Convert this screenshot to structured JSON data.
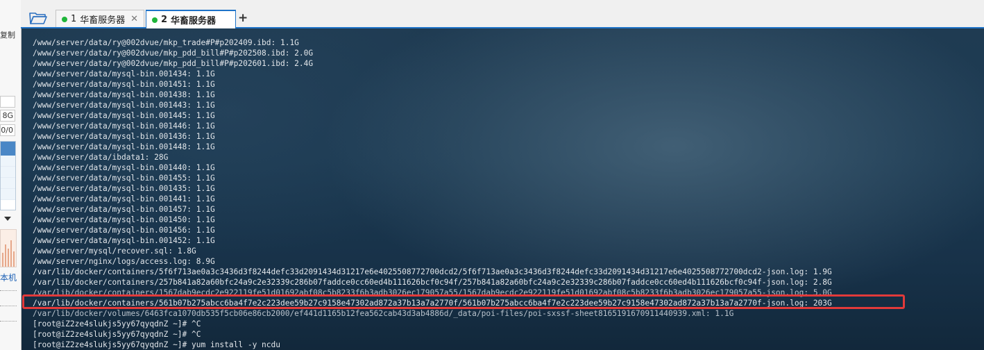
{
  "side_panel": {
    "copy_text": "复制",
    "values": [
      "",
      "8G",
      "0/0"
    ],
    "link_text": "本机"
  },
  "tabs": [
    {
      "number": "1",
      "label": "华畜服务器",
      "active": false,
      "status": "connected"
    },
    {
      "number": "2",
      "label": "华畜服务器",
      "active": true,
      "status": "connected"
    }
  ],
  "colors": {
    "status_connected": "#1fb53a",
    "highlight": "#e23a3a",
    "accent": "#1e73c8"
  },
  "icons": {
    "folder": "folder-open-icon",
    "close": "close-icon",
    "add": "plus-icon"
  },
  "terminal": {
    "lines": [
      "/www/server/data/ry@002dvue/mkp_trade#P#p202409.ibd: 1.1G",
      "/www/server/data/ry@002dvue/mkp_pdd_bill#P#p202508.ibd: 2.0G",
      "/www/server/data/ry@002dvue/mkp_pdd_bill#P#p202601.ibd: 2.4G",
      "/www/server/data/mysql-bin.001434: 1.1G",
      "/www/server/data/mysql-bin.001451: 1.1G",
      "/www/server/data/mysql-bin.001438: 1.1G",
      "/www/server/data/mysql-bin.001443: 1.1G",
      "/www/server/data/mysql-bin.001445: 1.1G",
      "/www/server/data/mysql-bin.001446: 1.1G",
      "/www/server/data/mysql-bin.001436: 1.1G",
      "/www/server/data/mysql-bin.001448: 1.1G",
      "/www/server/data/ibdata1: 28G",
      "/www/server/data/mysql-bin.001440: 1.1G",
      "/www/server/data/mysql-bin.001455: 1.1G",
      "/www/server/data/mysql-bin.001435: 1.1G",
      "/www/server/data/mysql-bin.001441: 1.1G",
      "/www/server/data/mysql-bin.001457: 1.1G",
      "/www/server/data/mysql-bin.001450: 1.1G",
      "/www/server/data/mysql-bin.001456: 1.1G",
      "/www/server/data/mysql-bin.001452: 1.1G",
      "/www/server/mysql/recover.sql: 1.8G",
      "/www/server/nginx/logs/access.log: 8.9G",
      "/var/lib/docker/containers/5f6f713ae0a3c3436d3f8244defc33d2091434d31217e6e4025508772700dcd2/5f6f713ae0a3c3436d3f8244defc33d2091434d31217e6e4025508772700dcd2-json.log: 1.9G",
      "/var/lib/docker/containers/257b841a82a60bfc24a9c2e32339c286b07faddce0cc60ed4b111626bcf0c94f/257b841a82a60bfc24a9c2e32339c286b07faddce0cc60ed4b111626bcf0c94f-json.log: 2.8G",
      "/var/lib/docker/containers/1567dab9ecdc2e922119fe51d01692abf08c5b8233f6b3adb3026ec179057a55/1567dab9ecdc2e922119fe51d01692abf08c5b8233f6b3adb3026ec179057a55-json.log: 5.0G",
      "/var/lib/docker/containers/561b07b275abcc6ba4f7e2c223dee59b27c9158e47302ad872a37b13a7a2770f/561b07b275abcc6ba4f7e2c223dee59b27c9158e47302ad872a37b13a7a2770f-json.log: 203G",
      "/var/lib/docker/volumes/6463fca1070db535f5cb06e86cb2000/ef441d1165b12fea562cab43d3ab4886d/_data/poi-files/poi-sxssf-sheet8165191670911440939.xml: 1.1G",
      "[root@iZ2ze4slukjs5yy67qyqdnZ ~]# ^C",
      "[root@iZ2ze4slukjs5yy67qyqdnZ ~]# ^C",
      "[root@iZ2ze4slukjs5yy67qyqdnZ ~]# yum install -y ncdu"
    ]
  }
}
